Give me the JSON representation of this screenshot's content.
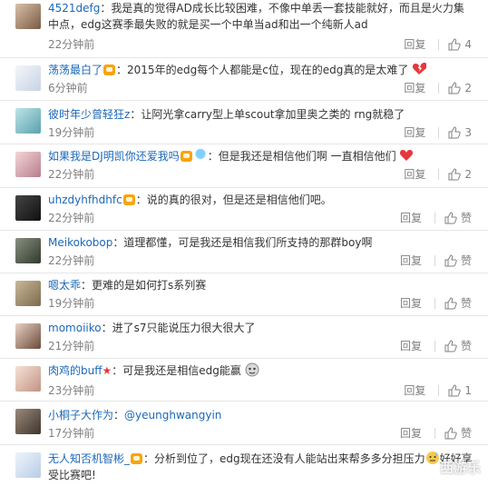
{
  "comments": [
    {
      "user": "4521defg",
      "sep": "：",
      "text": "我是真的觉得AD成长比较困难，不像中单丢一套技能就好，而且是火力集中点，edg这赛季最失败的就是买一个中单当ad和出一个纯新人ad",
      "time": "22分钟前",
      "reply": "回复",
      "likes": "4"
    },
    {
      "user": "荡荡最白了",
      "sep": "：",
      "text": "2015年的edg每个人都能是c位，现在的edg真的是太难了",
      "time": "6分钟前",
      "reply": "回复",
      "likes": "2"
    },
    {
      "user": "彼时年少曾轻狂z",
      "sep": "：",
      "text": "让阿光拿carry型上单scout拿加里奥之类的 rng就稳了",
      "time": "19分钟前",
      "reply": "回复",
      "likes": "3"
    },
    {
      "user": "如果我是DJ明凯你还爱我吗",
      "sep": "：",
      "text": "但是我还是相信他们啊 一直相信他们",
      "time": "22分钟前",
      "reply": "回复",
      "likes": "2"
    },
    {
      "user": "uhzdyhfhdhfc",
      "sep": "：",
      "text": "说的真的很对，但是还是相信他们吧。",
      "time": "22分钟前",
      "reply": "回复",
      "likes": "赞"
    },
    {
      "user": "Meikokobop",
      "sep": "：",
      "text": "道理都懂，可是我还是相信我们所支持的那群boy啊",
      "time": "22分钟前",
      "reply": "回复",
      "likes": "赞"
    },
    {
      "user": "嗯太乖",
      "sep": "：",
      "text": "更难的是如何打s系列赛",
      "time": "19分钟前",
      "reply": "回复",
      "likes": "赞"
    },
    {
      "user": "momoiiko",
      "sep": "：",
      "text": "进了s7只能说压力很大很大了",
      "time": "21分钟前",
      "reply": "回复",
      "likes": "赞"
    },
    {
      "user": "肉鸡的buff",
      "sep": "：",
      "text": "可是我还是相信edg能赢",
      "time": "23分钟前",
      "reply": "回复",
      "likes": "1"
    },
    {
      "user": "小桐子大作为",
      "sep": "：",
      "text": "@yeunghwangyin",
      "time": "17分钟前",
      "reply": "回复",
      "likes": "赞"
    },
    {
      "user": "无人知否机智彬_",
      "sep": "：",
      "text": "分析到位了，edg现在还没有人能站出来帮多多分担压力",
      "text2": "好好享受比赛吧!",
      "time": "",
      "reply": "",
      "likes": ""
    }
  ],
  "colors": {
    "username": "#eb7350",
    "link": "#1b68b8",
    "meta": "#808080"
  },
  "watermark": "西游乐"
}
